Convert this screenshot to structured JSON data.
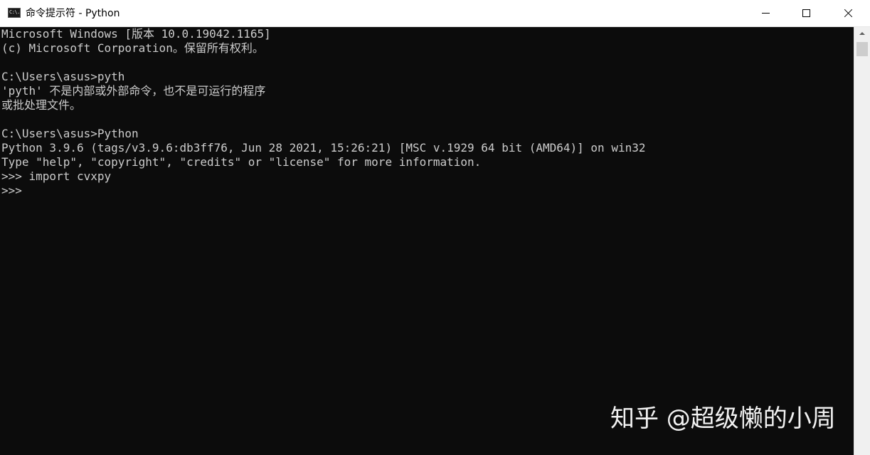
{
  "window": {
    "title": "命令提示符 - Python",
    "icon_label": "C:\\."
  },
  "controls": {
    "minimize": "minimize",
    "maximize": "maximize",
    "close": "close"
  },
  "console": {
    "lines": [
      "Microsoft Windows [版本 10.0.19042.1165]",
      "(c) Microsoft Corporation。保留所有权利。",
      "",
      "C:\\Users\\asus>pyth",
      "'pyth' 不是内部或外部命令，也不是可运行的程序",
      "或批处理文件。",
      "",
      "C:\\Users\\asus>Python",
      "Python 3.9.6 (tags/v3.9.6:db3ff76, Jun 28 2021, 15:26:21) [MSC v.1929 64 bit (AMD64)] on win32",
      "Type \"help\", \"copyright\", \"credits\" or \"license\" for more information.",
      ">>> import cvxpy",
      ">>>"
    ],
    "background": "#0c0c0c",
    "foreground": "#cccccc"
  },
  "watermark": "知乎 @超级懒的小周",
  "icons": {
    "app": "cmd-icon",
    "minimize": "minimize-icon",
    "maximize": "maximize-icon",
    "close": "close-icon",
    "scroll_up": "chevron-up-icon"
  }
}
